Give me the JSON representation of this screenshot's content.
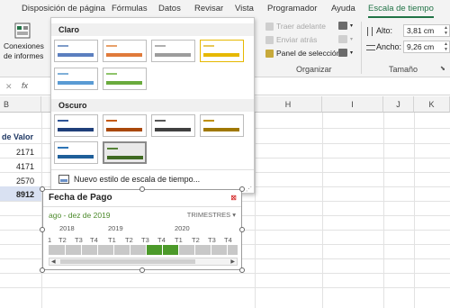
{
  "tabs": [
    "Disposición de página",
    "Fórmulas",
    "Datos",
    "Revisar",
    "Vista",
    "Programador",
    "Ayuda",
    "Escala de tiempo"
  ],
  "ribbon": {
    "conexiones_line1": "Conexiones",
    "conexiones_line2": "de informes",
    "traer_adelante": "Traer adelante",
    "enviar_atras": "Enviar atrás",
    "panel_seleccion": "Panel de selección",
    "organizar": "Organizar",
    "alto_label": "Alto:",
    "alto_value": "3,81 cm",
    "ancho_label": "Ancho:",
    "ancho_value": "9,26 cm",
    "tamano": "Tamaño"
  },
  "formula_bar": {
    "cancel_glyph": "✕",
    "fx": "fx"
  },
  "columns": [
    "B",
    "H",
    "I",
    "J",
    "K"
  ],
  "cells": {
    "header": "de Valor",
    "v1": "2171",
    "v2": "4171",
    "v3": "2570",
    "v4": "8912"
  },
  "gallery": {
    "light_label": "Claro",
    "dark_label": "Oscuro",
    "new_style": "Nuevo estilo de escala de tiempo..."
  },
  "timeline": {
    "title": "Fecha de Pago",
    "range": "ago - dez de 2019",
    "level": "TRIMESTRES",
    "years": [
      "2018",
      "2019",
      "2020"
    ],
    "quarters": [
      "1",
      "T2",
      "T3",
      "T4",
      "T1",
      "T2",
      "T3",
      "T4",
      "T1",
      "T2",
      "T3",
      "T4"
    ]
  },
  "colors": {
    "accent": "#217346",
    "selection_green": "#4c9a2a",
    "highlight_yellow": "#e6b800"
  }
}
